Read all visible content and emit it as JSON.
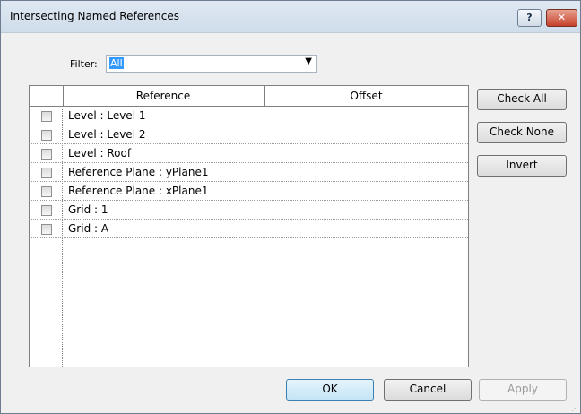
{
  "window": {
    "title": "Intersecting Named References",
    "help_label": "?",
    "close_label": "✕"
  },
  "filter": {
    "label": "Filter:",
    "value": "All"
  },
  "table": {
    "columns": [
      "Reference",
      "Offset"
    ],
    "rows": [
      {
        "reference": "Level : Level 1",
        "offset": ""
      },
      {
        "reference": "Level : Level 2",
        "offset": ""
      },
      {
        "reference": "Level : Roof",
        "offset": ""
      },
      {
        "reference": "Reference Plane : yPlane1",
        "offset": ""
      },
      {
        "reference": "Reference Plane : xPlane1",
        "offset": ""
      },
      {
        "reference": "Grid : 1",
        "offset": ""
      },
      {
        "reference": "Grid : A",
        "offset": ""
      }
    ]
  },
  "buttons": {
    "check_all": "Check All",
    "check_none": "Check None",
    "invert": "Invert",
    "ok": "OK",
    "cancel": "Cancel",
    "apply": "Apply"
  },
  "icons": {
    "help": "question-icon",
    "close": "close-icon",
    "dropdown": "chevron-down-icon",
    "grip": "resize-grip-icon"
  }
}
